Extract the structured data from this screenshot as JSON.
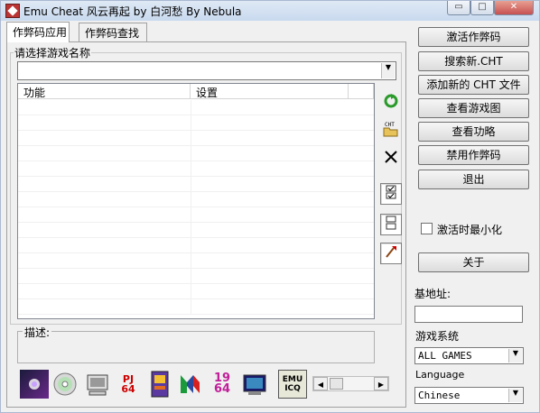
{
  "window": {
    "title": "Emu Cheat 风云再起 by 白河愁  By Nebula",
    "controls": {
      "minimize": "▭",
      "maximize": "□",
      "close": "✕"
    }
  },
  "tabs": [
    {
      "label": "作弊码应用",
      "active": true
    },
    {
      "label": "作弊码查找",
      "active": false
    }
  ],
  "game_select": {
    "label": "请选择游戏名称",
    "value": ""
  },
  "list": {
    "columns": [
      "功能",
      "设置"
    ]
  },
  "description": {
    "label": "描述:"
  },
  "side_tools": [
    "refresh-icon",
    "open-cht-icon",
    "delete-icon",
    "check-all-icon",
    "uncheck-all-icon",
    "edit-icon"
  ],
  "system_icons": [
    "emulator-icon",
    "cd-icon",
    "computer-icon",
    "pj64-icon",
    "arcade-icon",
    "n64-icon",
    "1964-icon",
    "screen-icon",
    "emu-icq-icon"
  ],
  "system_icon_text": {
    "pj64": "PJ\n64",
    "n1964": "19\n64",
    "icq": "EMU\nICQ"
  },
  "buttons": {
    "activate": "激活作弊码",
    "search_new": "搜索新.CHT",
    "add_cht": "添加新的 CHT 文件",
    "view_map": "查看游戏图",
    "view_guide": "查看功略",
    "disable": "禁用作弊码",
    "exit": "退出",
    "about": "关于"
  },
  "minimize_on_activate": {
    "label": "激活时最小化",
    "checked": false
  },
  "base_address": {
    "label": "基地址:",
    "value": ""
  },
  "game_system": {
    "label": "游戏系统",
    "value": "ALL GAMES"
  },
  "language": {
    "label": "Language",
    "value": "Chinese"
  },
  "colors": {
    "window_bg": "#f0f0f0",
    "accent_green": "#2a9a2a",
    "close_red": "#c75050"
  }
}
